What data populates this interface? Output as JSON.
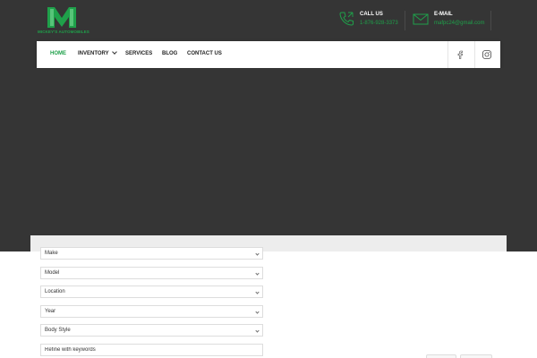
{
  "header": {
    "logo_text": "MICKEY'S AUTOMOBILES",
    "call": {
      "label": "CALL US",
      "value": "1-876-928-3373",
      "icon": "phone-icon"
    },
    "email": {
      "label": "E-MAIL",
      "value": "mafpc24@gmail.com",
      "icon": "envelope-icon"
    }
  },
  "nav": {
    "items": [
      {
        "label": "HOME",
        "active": true
      },
      {
        "label": "INVENTORY",
        "dropdown": true
      },
      {
        "label": "SERVICES"
      },
      {
        "label": "BLOG"
      },
      {
        "label": "CONTACT US"
      }
    ],
    "social": [
      "facebook-icon",
      "instagram-icon"
    ]
  },
  "search": {
    "selects": [
      {
        "label": "Make"
      },
      {
        "label": "Model"
      },
      {
        "label": "Location"
      },
      {
        "label": "Year"
      },
      {
        "label": "Body Style"
      }
    ],
    "keywords_placeholder": "Refine with keywords"
  },
  "colors": {
    "accent": "#1fa04a",
    "background": "#353535",
    "panel_header": "#ededed"
  }
}
